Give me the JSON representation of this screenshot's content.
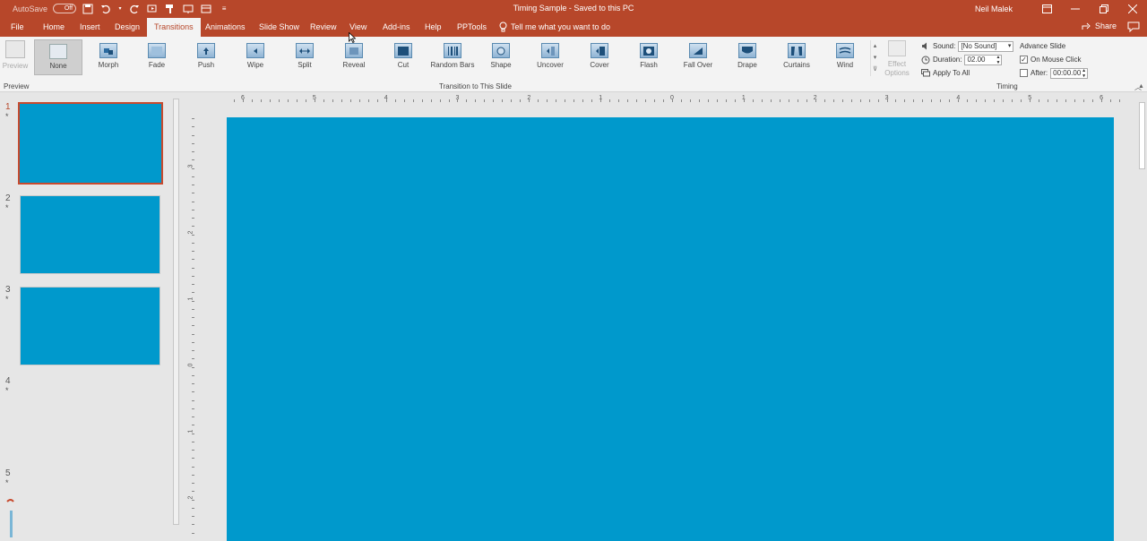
{
  "titlebar": {
    "autosave_label": "AutoSave",
    "autosave_state": "Off",
    "title": "Timing Sample  -  Saved to this PC",
    "user": "Neil Malek",
    "bg_color": "#b7472a"
  },
  "qat_icons": [
    "save-icon",
    "undo-icon",
    "redo-icon",
    "start-from-beginning-icon",
    "format-painter-icon",
    "present-icon",
    "layout-icon",
    "customize-qat-icon"
  ],
  "tabs": [
    {
      "label": "File"
    },
    {
      "label": "Home"
    },
    {
      "label": "Insert"
    },
    {
      "label": "Design"
    },
    {
      "label": "Transitions",
      "active": true
    },
    {
      "label": "Animations"
    },
    {
      "label": "Slide Show"
    },
    {
      "label": "Review"
    },
    {
      "label": "View"
    },
    {
      "label": "Add-ins"
    },
    {
      "label": "Help"
    },
    {
      "label": "PPTools"
    }
  ],
  "tellme": "Tell me what you want to do",
  "share": "Share",
  "ribbon": {
    "preview_label": "Preview",
    "transitions": [
      {
        "label": "None",
        "icon": "none-icon",
        "selected": true
      },
      {
        "label": "Morph",
        "icon": "morph-icon"
      },
      {
        "label": "Fade",
        "icon": "fade-icon"
      },
      {
        "label": "Push",
        "icon": "push-icon"
      },
      {
        "label": "Wipe",
        "icon": "wipe-icon"
      },
      {
        "label": "Split",
        "icon": "split-icon"
      },
      {
        "label": "Reveal",
        "icon": "reveal-icon"
      },
      {
        "label": "Cut",
        "icon": "cut-icon"
      },
      {
        "label": "Random Bars",
        "icon": "random-bars-icon"
      },
      {
        "label": "Shape",
        "icon": "shape-icon"
      },
      {
        "label": "Uncover",
        "icon": "uncover-icon"
      },
      {
        "label": "Cover",
        "icon": "cover-icon"
      },
      {
        "label": "Flash",
        "icon": "flash-icon"
      },
      {
        "label": "Fall Over",
        "icon": "fall-over-icon"
      },
      {
        "label": "Drape",
        "icon": "drape-icon"
      },
      {
        "label": "Curtains",
        "icon": "curtains-icon"
      },
      {
        "label": "Wind",
        "icon": "wind-icon"
      }
    ],
    "effect_options_line1": "Effect",
    "effect_options_line2": "Options",
    "sound_label": "Sound:",
    "sound_value": "[No Sound]",
    "duration_label": "Duration:",
    "duration_value": "02.00",
    "apply_all_label": "Apply To All",
    "advance_title": "Advance Slide",
    "on_mouse_click_label": "On Mouse Click",
    "on_mouse_click_checked": true,
    "after_label": "After:",
    "after_value": "00:00.00",
    "after_checked": false,
    "group_preview": "Preview",
    "group_transition": "Transition to This Slide",
    "group_timing": "Timing"
  },
  "slides": [
    {
      "number": "1",
      "star": "*",
      "selected": true,
      "color": "#0099cc"
    },
    {
      "number": "2",
      "star": "*",
      "color": "#0099cc"
    },
    {
      "number": "3",
      "star": "*",
      "color": "#0099cc"
    },
    {
      "number": "4",
      "star": "*"
    },
    {
      "number": "5",
      "star": "*"
    }
  ],
  "ruler": {
    "horizontal_labels": [
      "6",
      "5",
      "4",
      "3",
      "2",
      "1",
      "0",
      "1",
      "2",
      "3",
      "4",
      "5",
      "6"
    ],
    "vertical_labels": [
      "3",
      "2",
      "1",
      "0",
      "1",
      "2"
    ]
  },
  "slide_color": "#0099cc"
}
